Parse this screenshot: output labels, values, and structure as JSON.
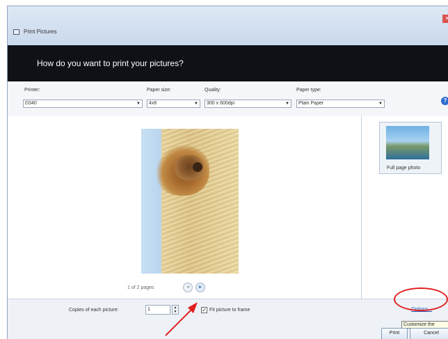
{
  "window": {
    "title": "Print Pictures",
    "close_label": "✕"
  },
  "banner": {
    "heading": "How do you want to print your pictures?"
  },
  "options": {
    "printer": {
      "label": "Printer:",
      "value": "D340"
    },
    "paper_size": {
      "label": "Paper size:",
      "value": "4x6"
    },
    "quality": {
      "label": "Quality:",
      "value": "300 x 600dpi"
    },
    "paper_type": {
      "label": "Paper type:",
      "value": "Plain Paper"
    },
    "help_label": "?"
  },
  "preview": {
    "page_count": "1 of 2 pages",
    "prev_label": "◂",
    "next_label": "▸"
  },
  "layouts": {
    "items": [
      {
        "label": "Full page photo"
      }
    ]
  },
  "bottom": {
    "copies_label": "Copies of each picture:",
    "copies_value": "1",
    "spinner_label": "▲\n▼",
    "fit_label": "Fit picture to frame",
    "fit_checked_mark": "✓",
    "options_link": "Options...",
    "tooltip": "Customize the",
    "print_button": "Print",
    "cancel_button": "Cancel"
  },
  "annotations": {
    "arrow_color": "#e01f1f",
    "ellipse_color": "#e01f1f"
  }
}
